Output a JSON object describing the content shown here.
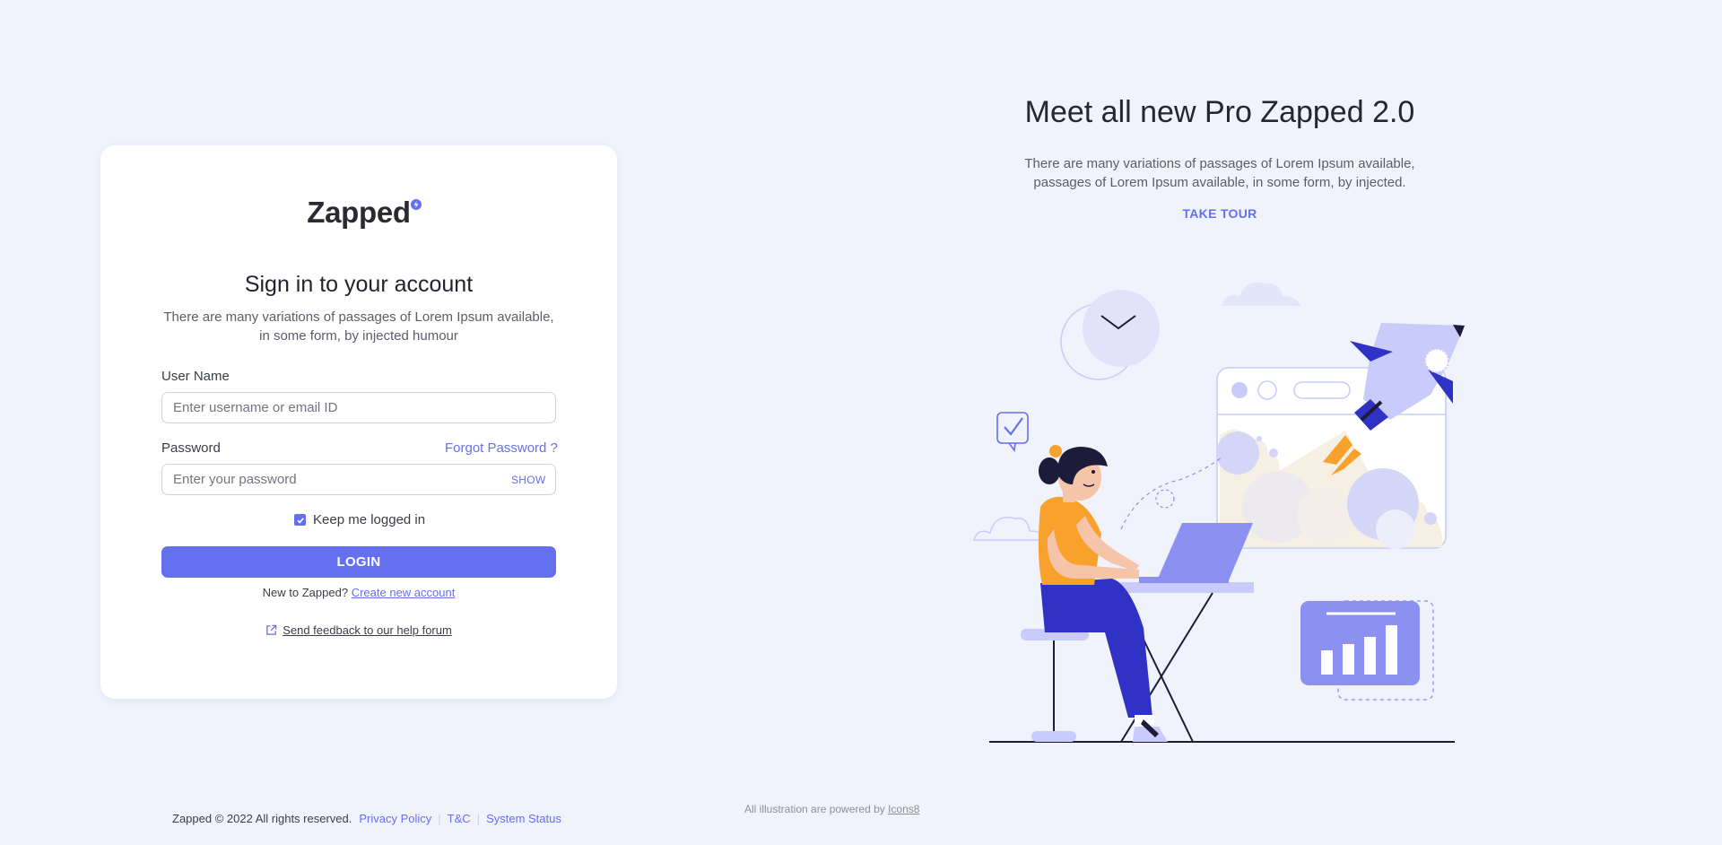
{
  "app": {
    "name": "Zapped"
  },
  "login": {
    "title": "Sign in to your account",
    "subtitle": "There are many variations of passages of Lorem Ipsum available, in some form, by injected humour",
    "username_label": "User Name",
    "username_placeholder": "Enter username or email ID",
    "password_label": "Password",
    "forgot_label": "Forgot Password ?",
    "password_placeholder": "Enter your password",
    "show_label": "SHOW",
    "keep_logged_in_label": "Keep me logged in",
    "keep_logged_in_checked": true,
    "login_button": "LOGIN",
    "new_user_prefix": "New to Zapped?",
    "create_account_link": "Create new account",
    "feedback_link": "Send feedback to our help forum"
  },
  "promo": {
    "title": "Meet all new Pro Zapped 2.0",
    "subtitle_line1": "There are many variations of passages of Lorem Ipsum available,",
    "subtitle_line2": "passages of Lorem Ipsum available, in some form, by injected.",
    "take_tour": "TAKE TOUR"
  },
  "footer": {
    "copyright": "Zapped © 2022 All rights reserved.",
    "links": [
      "Privacy Policy",
      "T&C",
      "System Status"
    ],
    "credit_prefix": "All illustration are powered by",
    "credit_link": "Icons8"
  },
  "icons": {
    "logo_badge": "bolt-icon",
    "checkbox": "check-icon",
    "feedback": "external-link-icon"
  },
  "colors": {
    "accent": "#6470ef",
    "background": "#f0f3fc",
    "card": "#ffffff",
    "illustration_primary": "#2f32c4",
    "illustration_secondary": "#f9a12d",
    "illustration_light": "#c9cbfa"
  }
}
